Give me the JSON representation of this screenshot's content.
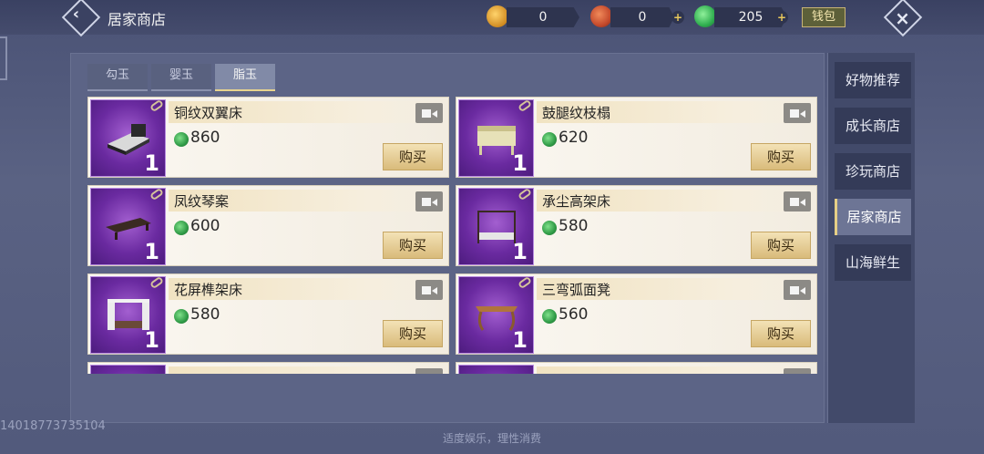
{
  "header": {
    "back_icon": "chevron-left",
    "title": "居家商店",
    "currencies": [
      {
        "icon": "gold-pouch-icon",
        "value": "0",
        "color": "#e6a43a"
      },
      {
        "icon": "red-coin-icon",
        "value": "0",
        "color": "#c54a2c"
      },
      {
        "icon": "jade-icon",
        "value": "205",
        "color": "#2fae4f"
      }
    ],
    "money_bag_label": "钱包",
    "close_icon": "close"
  },
  "tabs": [
    {
      "label": "勾玉",
      "active": false
    },
    {
      "label": "婴玉",
      "active": false
    },
    {
      "label": "脂玉",
      "active": true
    }
  ],
  "items": [
    {
      "name": "铜纹双翼床",
      "price": "860",
      "qty": "1",
      "buy_label": "购买",
      "thumb_shape": "bed"
    },
    {
      "name": "鼓腿纹枝榻",
      "price": "620",
      "qty": "1",
      "buy_label": "购买",
      "thumb_shape": "couch"
    },
    {
      "name": "凤纹琴案",
      "price": "600",
      "qty": "1",
      "buy_label": "购买",
      "thumb_shape": "table"
    },
    {
      "name": "承尘高架床",
      "price": "580",
      "qty": "1",
      "buy_label": "购买",
      "thumb_shape": "canopy-bed"
    },
    {
      "name": "花屏榫架床",
      "price": "580",
      "qty": "1",
      "buy_label": "购买",
      "thumb_shape": "curtain-bed"
    },
    {
      "name": "三弯弧面凳",
      "price": "560",
      "qty": "1",
      "buy_label": "购买",
      "thumb_shape": "stool"
    },
    {
      "name": "",
      "price": "",
      "qty": "",
      "buy_label": "",
      "thumb_shape": "partial"
    },
    {
      "name": "",
      "price": "",
      "qty": "",
      "buy_label": "",
      "thumb_shape": "partial"
    }
  ],
  "side_menu": [
    {
      "label": "好物推荐",
      "active": false
    },
    {
      "label": "成长商店",
      "active": false
    },
    {
      "label": "珍玩商店",
      "active": false
    },
    {
      "label": "居家商店",
      "active": true
    },
    {
      "label": "山海鲜生",
      "active": false
    }
  ],
  "uid_text": "14018773735104",
  "footer_text": "适度娱乐，理性消费"
}
